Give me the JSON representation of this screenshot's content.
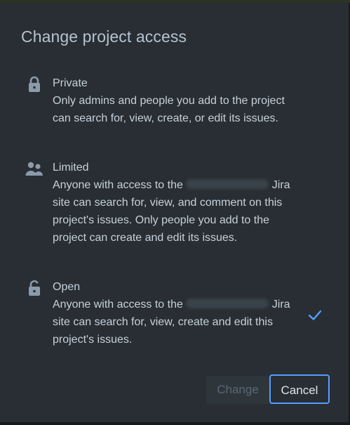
{
  "dialog": {
    "title": "Change project access",
    "options": [
      {
        "label": "Private",
        "icon": "lock-icon",
        "description": "Only admins and people you add to the project can search for, view, create, or edit its issues.",
        "selected": false
      },
      {
        "label": "Limited",
        "icon": "people-icon",
        "description_before_site": "Anyone with access to the",
        "description_after_site": "Jira site can search for, view, and comment on this project's issues. Only people you add to the project can create and edit its issues.",
        "selected": false
      },
      {
        "label": "Open",
        "icon": "unlock-icon",
        "description_before_site": "Anyone with access to the",
        "description_after_site": "Jira site can search for, view, create and edit this project's issues.",
        "selected": true
      }
    ],
    "buttons": {
      "change_label": "Change",
      "cancel_label": "Cancel"
    }
  },
  "colors": {
    "background": "#282e33",
    "text": "#c7d1db",
    "accent": "#579dff",
    "disabled_text": "#596773"
  }
}
